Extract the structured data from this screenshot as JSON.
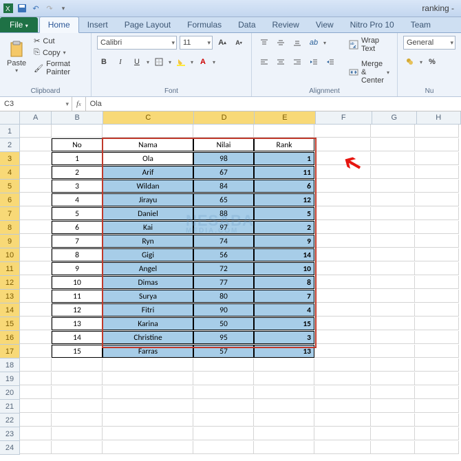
{
  "title_right": "ranking -",
  "tabs": [
    "File",
    "Home",
    "Insert",
    "Page Layout",
    "Formulas",
    "Data",
    "Review",
    "View",
    "Nitro Pro 10",
    "Team"
  ],
  "active_tab": "Home",
  "clipboard": {
    "paste": "Paste",
    "cut": "Cut",
    "copy": "Copy",
    "fp": "Format Painter",
    "group": "Clipboard"
  },
  "font": {
    "name": "Calibri",
    "size": "11",
    "group": "Font"
  },
  "align": {
    "wrap": "Wrap Text",
    "merge": "Merge & Center",
    "group": "Alignment"
  },
  "number": {
    "fmt": "General",
    "group": "Nu"
  },
  "namebox": "C3",
  "formula": "Ola",
  "cols": [
    "A",
    "B",
    "C",
    "D",
    "E",
    "F",
    "G",
    "H"
  ],
  "sel_cols": [
    "C",
    "D",
    "E"
  ],
  "headers": {
    "no": "No",
    "nama": "Nama",
    "nilai": "Nilai",
    "rank": "Rank"
  },
  "rows": [
    {
      "no": 1,
      "nama": "Ola",
      "nilai": 98,
      "rank": 1
    },
    {
      "no": 2,
      "nama": "Arif",
      "nilai": 67,
      "rank": 11
    },
    {
      "no": 3,
      "nama": "Wildan",
      "nilai": 84,
      "rank": 6
    },
    {
      "no": 4,
      "nama": "Jirayu",
      "nilai": 65,
      "rank": 12
    },
    {
      "no": 5,
      "nama": "Daniel",
      "nilai": 88,
      "rank": 5
    },
    {
      "no": 6,
      "nama": "Kai",
      "nilai": 97,
      "rank": 2
    },
    {
      "no": 7,
      "nama": "Ryn",
      "nilai": 74,
      "rank": 9
    },
    {
      "no": 8,
      "nama": "Gigi",
      "nilai": 56,
      "rank": 14
    },
    {
      "no": 9,
      "nama": "Angel",
      "nilai": 72,
      "rank": 10
    },
    {
      "no": 10,
      "nama": "Dimas",
      "nilai": 77,
      "rank": 8
    },
    {
      "no": 11,
      "nama": "Surya",
      "nilai": 80,
      "rank": 7
    },
    {
      "no": 12,
      "nama": "Fitri",
      "nilai": 90,
      "rank": 4
    },
    {
      "no": 13,
      "nama": "Karina",
      "nilai": 50,
      "rank": 15
    },
    {
      "no": 14,
      "nama": "Christine",
      "nilai": 95,
      "rank": 3
    },
    {
      "no": 15,
      "nama": "Farras",
      "nilai": 57,
      "rank": 13
    }
  ],
  "watermark": "NESABA",
  "watermark2": "MEDIA.COM"
}
